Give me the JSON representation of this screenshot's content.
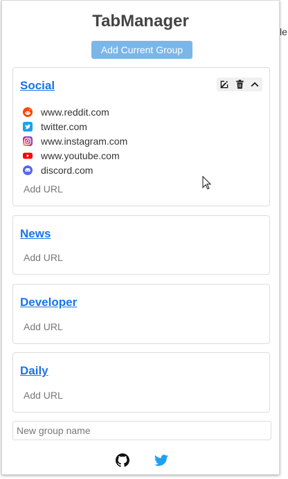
{
  "app": {
    "title": "TabManager",
    "add_current_group": "Add Current Group"
  },
  "background": {
    "edge_text": "le"
  },
  "groups": [
    {
      "name": "Social",
      "urls": [
        {
          "text": "www.reddit.com",
          "icon": "reddit-icon"
        },
        {
          "text": "twitter.com",
          "icon": "twitter-icon"
        },
        {
          "text": "www.instagram.com",
          "icon": "instagram-icon"
        },
        {
          "text": "www.youtube.com",
          "icon": "youtube-icon"
        },
        {
          "text": "discord.com",
          "icon": "discord-icon"
        }
      ],
      "add_url": "Add URL"
    },
    {
      "name": "News",
      "urls": [],
      "add_url": "Add URL"
    },
    {
      "name": "Developer",
      "urls": [],
      "add_url": "Add URL"
    },
    {
      "name": "Daily",
      "urls": [],
      "add_url": "Add URL"
    }
  ],
  "new_group": {
    "placeholder": "New group name"
  },
  "footer": {
    "icons": [
      "github-icon",
      "twitter-icon"
    ]
  },
  "colors": {
    "accent": "#1a73e8",
    "button": "#7bb6e8",
    "twitter": "#1da1f2"
  }
}
